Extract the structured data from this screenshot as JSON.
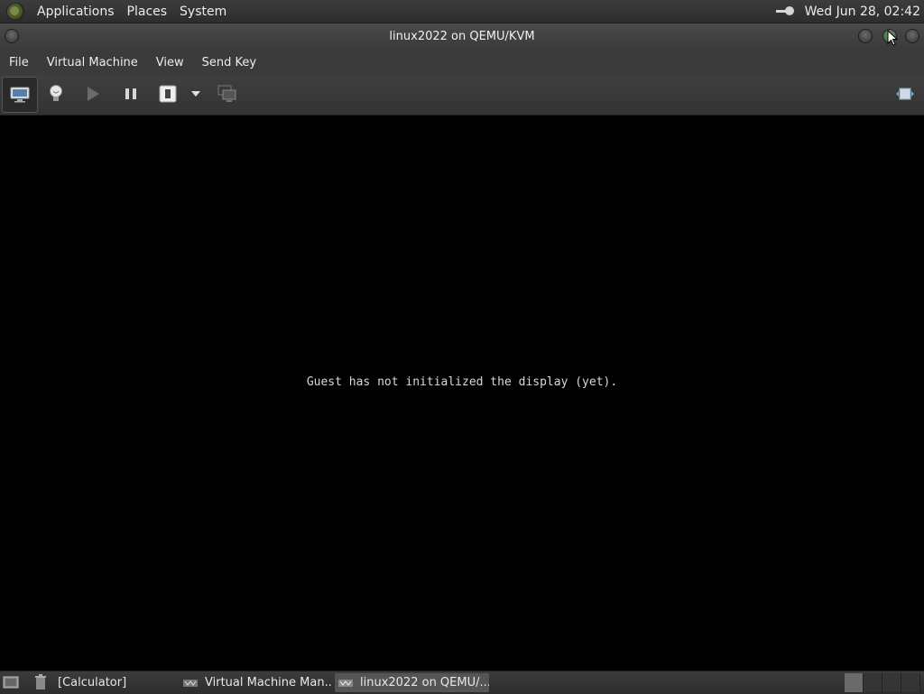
{
  "top_panel": {
    "menus": [
      "Applications",
      "Places",
      "System"
    ],
    "clock": "Wed Jun 28, 02:42"
  },
  "window": {
    "title": "linux2022 on QEMU/KVM"
  },
  "menu_bar": {
    "items": [
      "File",
      "Virtual Machine",
      "View",
      "Send Key"
    ]
  },
  "toolbar": {
    "icons": [
      "console-icon",
      "details-lightbulb-icon",
      "run-icon",
      "pause-icon",
      "shutdown-icon",
      "shutdown-dropdown-icon",
      "snapshots-icon",
      "fullscreen-icon"
    ]
  },
  "console": {
    "message": "Guest has not initialized the display (yet)."
  },
  "taskbar": {
    "tasks": [
      "[Calculator]",
      "Virtual Machine Man...",
      "linux2022 on QEMU/..."
    ]
  }
}
